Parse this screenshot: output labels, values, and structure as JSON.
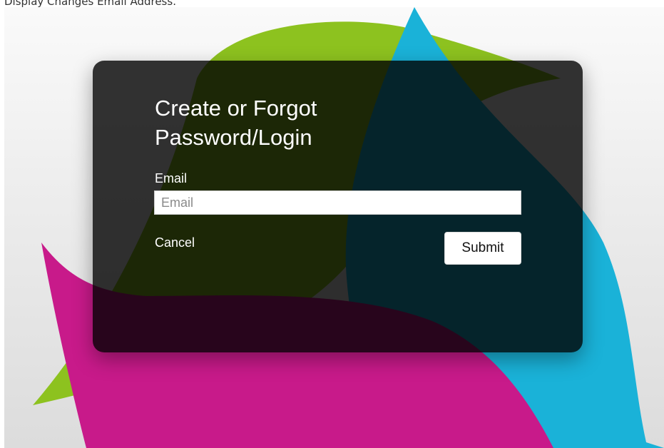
{
  "page": {
    "top_text": "Display Changes Email Address."
  },
  "colors": {
    "green_shape": "#8dc21f",
    "cyan_shape": "#1ab2d8",
    "magenta_shape": "#c81a8a",
    "dialog_overlay": "rgba(0,0,0,0.8)"
  },
  "dialog": {
    "title": "Create or Forgot Password/Login",
    "email_label": "Email",
    "email_value": "",
    "email_placeholder": "Email",
    "cancel_label": "Cancel",
    "submit_label": "Submit"
  }
}
